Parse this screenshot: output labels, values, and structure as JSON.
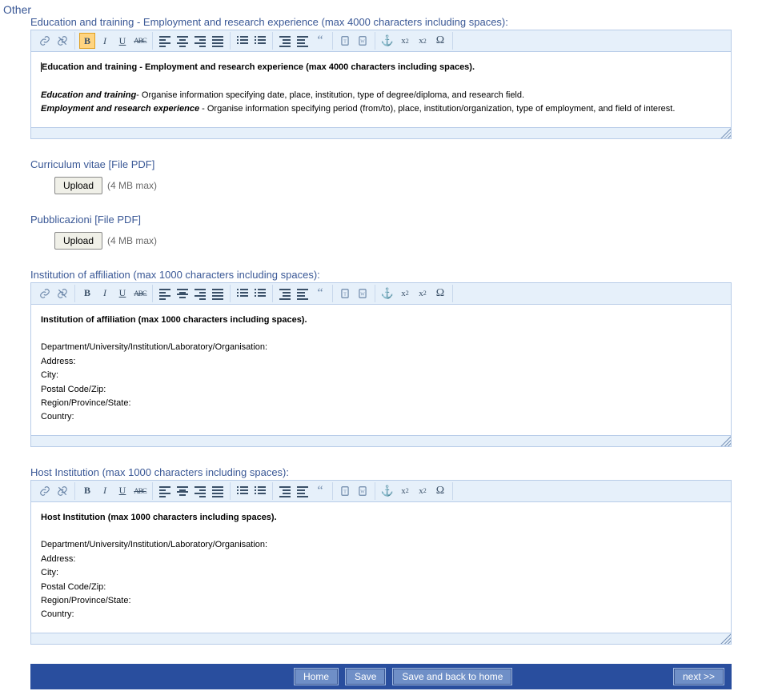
{
  "heading": "Other",
  "sections": {
    "edu": {
      "label": "Education and training - Employment and research experience (max 4000 characters including spaces):",
      "content_title": "Education and training - Employment and research experience (max 4000 characters including spaces).",
      "edu_lead": "Education and training",
      "edu_text": "- Organise information specifying date, place, institution, type of degree/diploma, and research field.",
      "emp_lead": "Employment and research experience",
      "emp_text": " - Organise information specifying period (from/to), place, institution/organization, type of employment, and field of interest."
    },
    "cv": {
      "label": "Curriculum vitae [File PDF]",
      "upload_label": "Upload",
      "hint": "(4 MB max)"
    },
    "pub": {
      "label": "Pubblicazioni [File PDF]",
      "upload_label": "Upload",
      "hint": "(4 MB max)"
    },
    "affil": {
      "label": "Institution of affiliation (max 1000 characters including spaces):",
      "content_title": "Institution of affiliation (max 1000 characters including spaces).",
      "l1": "Department/University/Institution/Laboratory/Organisation:",
      "l2": "Address:",
      "l3": "City:",
      "l4": "Postal Code/Zip:",
      "l5": "Region/Province/State:",
      "l6": "Country:"
    },
    "host": {
      "label": "Host Institution (max 1000 characters including spaces):",
      "content_title": "Host Institution (max 1000 characters including spaces).",
      "l1": "Department/University/Institution/Laboratory/Organisation:",
      "l2": "Address:",
      "l3": "City:",
      "l4": "Postal Code/Zip:",
      "l5": "Region/Province/State:",
      "l6": "Country:"
    }
  },
  "footer": {
    "home": "Home",
    "save": "Save",
    "save_back": "Save and back to home",
    "next": "next >>"
  },
  "toolbar_icons": {
    "link": "link-icon",
    "unlink": "unlink-icon",
    "bold": "B",
    "italic": "I",
    "underline": "U",
    "strike": "ABC",
    "align_left": "align-left-icon",
    "align_center": "align-center-icon",
    "align_right": "align-right-icon",
    "align_justify": "align-justify-icon",
    "bullets": "bullet-list-icon",
    "numbers": "numbered-list-icon",
    "outdent": "outdent-icon",
    "indent": "indent-icon",
    "quote": "“",
    "paste_text": "paste-text-icon",
    "paste_word": "paste-word-icon",
    "anchor": "⚓",
    "sub": "x₂",
    "sup": "x²",
    "omega": "Ω"
  }
}
